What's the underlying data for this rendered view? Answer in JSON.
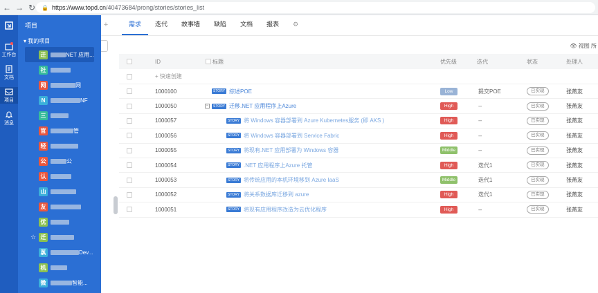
{
  "browser": {
    "url_host": "https://www.topd.cn",
    "url_path": "/40473684/prong/stories/stories_list"
  },
  "rail": [
    {
      "label": "工作台",
      "icon": "workbench-icon"
    },
    {
      "label": "文档",
      "icon": "document-icon"
    },
    {
      "label": "项目",
      "icon": "project-icon"
    },
    {
      "label": "消息",
      "icon": "bell-icon"
    }
  ],
  "panel": {
    "title": "项目",
    "group_label": "我的项目",
    "projects": [
      {
        "badge": "迁",
        "color": "#8cc152",
        "name": "NET 应用..."
      },
      {
        "badge": "社",
        "color": "#37bc9b",
        "name": ""
      },
      {
        "badge": "网",
        "color": "#e9573f",
        "name": "网"
      },
      {
        "badge": "N",
        "color": "#3bafda",
        "name": "NF"
      },
      {
        "badge": "三",
        "color": "#37bc9b",
        "name": ""
      },
      {
        "badge": "官",
        "color": "#e9573f",
        "name": "管"
      },
      {
        "badge": "轻",
        "color": "#e9573f",
        "name": ""
      },
      {
        "badge": "公",
        "color": "#e9573f",
        "name": "公"
      },
      {
        "badge": "认",
        "color": "#e9573f",
        "name": ""
      },
      {
        "badge": "山",
        "color": "#3bafda",
        "name": ""
      },
      {
        "badge": "友",
        "color": "#e9573f",
        "name": ""
      },
      {
        "badge": "优",
        "color": "#8cc152",
        "name": ""
      },
      {
        "badge": "迁",
        "color": "#8cc152",
        "name": ""
      },
      {
        "badge": "蒸",
        "color": "#3bafda",
        "name": "Dev..."
      },
      {
        "badge": "机",
        "color": "#8cc152",
        "name": ""
      },
      {
        "badge": "微",
        "color": "#3bafda",
        "name": "智能..."
      }
    ]
  },
  "tabs": [
    "需求",
    "迭代",
    "故事墙",
    "缺陷",
    "文档",
    "报表"
  ],
  "toolbar": {
    "display_label": "视图 所"
  },
  "table": {
    "headers": {
      "id": "ID",
      "title": "标题",
      "priority": "优先级",
      "iteration": "迭代",
      "status": "状态",
      "owner": "处理人"
    },
    "quick_create": "+ 快速创建",
    "rows": [
      {
        "id": "1000100",
        "title": "综述POE",
        "priority": "Low",
        "iteration": "提交POE",
        "status": "已实现",
        "owner": "张燕友",
        "indent": 0,
        "tree": false
      },
      {
        "id": "1000050",
        "title": "迁移.NET 应用程序上Azure",
        "priority": "High",
        "iteration": "--",
        "status": "已实现",
        "owner": "张燕友",
        "indent": 0,
        "tree": true
      },
      {
        "id": "1000057",
        "title": "将 Windows 容器部署到 Azure Kubernetes服务 (即 AKS )",
        "priority": "High",
        "iteration": "--",
        "status": "已实现",
        "owner": "张燕友",
        "indent": 1,
        "tree": false
      },
      {
        "id": "1000056",
        "title": "将 Windows 容器部署到 Service Fabric",
        "priority": "High",
        "iteration": "--",
        "status": "已实现",
        "owner": "张燕友",
        "indent": 1,
        "tree": false
      },
      {
        "id": "1000055",
        "title": "将现有.NET 应用部署为 Windows 容器",
        "priority": "Middle",
        "iteration": "--",
        "status": "已实现",
        "owner": "张燕友",
        "indent": 1,
        "tree": false
      },
      {
        "id": "1000054",
        "title": ".NET 应用程序上Azure 托管",
        "priority": "High",
        "iteration": "迭代1",
        "status": "已实现",
        "owner": "张燕友",
        "indent": 1,
        "tree": false
      },
      {
        "id": "1000053",
        "title": "将传统应用的本机环境移到 Azure IaaS",
        "priority": "Middle",
        "iteration": "迭代1",
        "status": "已实现",
        "owner": "张燕友",
        "indent": 1,
        "tree": false
      },
      {
        "id": "1000052",
        "title": "将关系数据库迁移到 azure",
        "priority": "High",
        "iteration": "迭代1",
        "status": "已实现",
        "owner": "张燕友",
        "indent": 1,
        "tree": false
      },
      {
        "id": "1000051",
        "title": "将现有应用程序改造为云优化程序",
        "priority": "High",
        "iteration": "--",
        "status": "已实现",
        "owner": "张燕友",
        "indent": 1,
        "tree": false
      }
    ]
  }
}
